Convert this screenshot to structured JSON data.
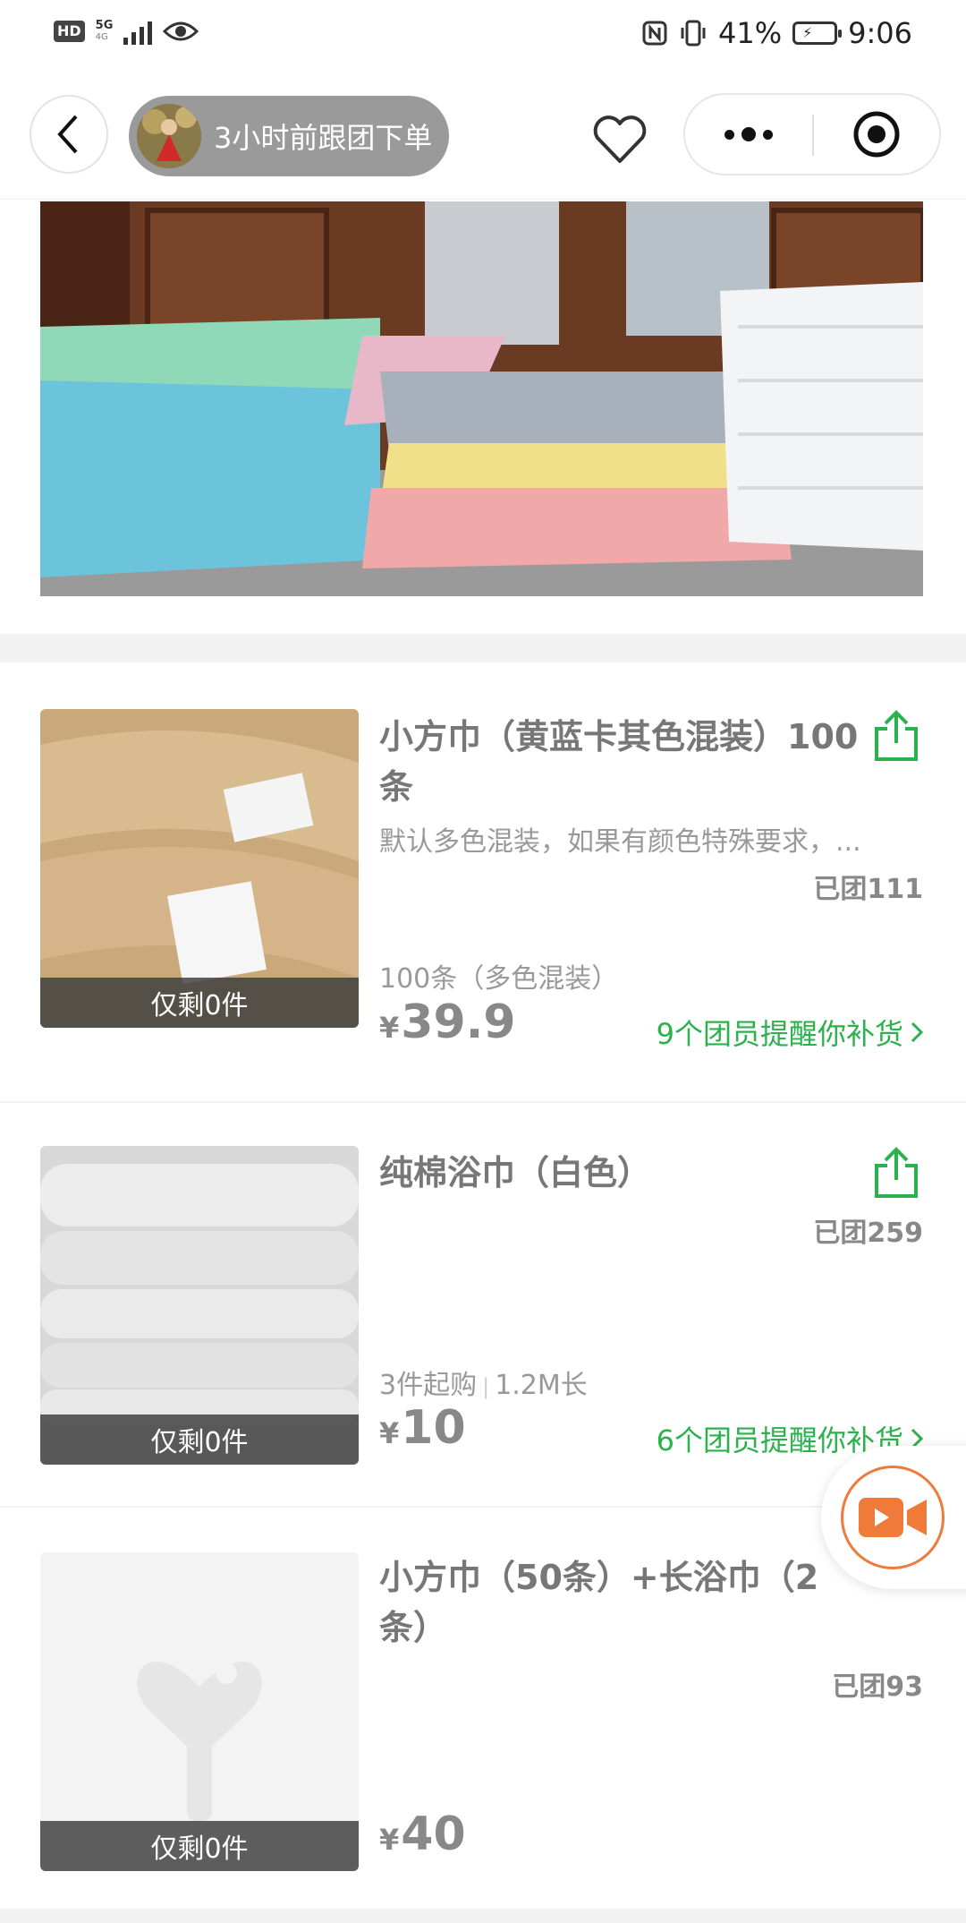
{
  "status_bar": {
    "hd": "HD",
    "network": "5G",
    "network_sub": "4G",
    "battery_percent": "41%",
    "time": "9:06"
  },
  "nav": {
    "order_notice": "3小时前跟团下单"
  },
  "products": [
    {
      "title": "小方巾（黄蓝卡其色混装）100条",
      "description": "默认多色混装，如果有颜色特殊要求，...",
      "sold": "已团111",
      "spec": "100条（多色混装）",
      "price_currency": "¥",
      "price": "39.9",
      "stock": "仅剩0件",
      "remind": "9个团员提醒你补货"
    },
    {
      "title": "纯棉浴巾（白色）",
      "sold": "已团259",
      "spec_a": "3件起购",
      "spec_b": "1.2M长",
      "price_currency": "¥",
      "price": "10",
      "stock": "仅剩0件",
      "remind": "6个团员提醒你补货"
    },
    {
      "title": "小方巾（50条）+长浴巾（2条）",
      "sold": "已团93",
      "price_currency": "¥",
      "price": "40",
      "stock": "仅剩0件"
    }
  ],
  "colors": {
    "accent_green": "#2bb24c",
    "video_orange": "#f07a3a"
  },
  "icons": [
    "back-icon",
    "heart-icon",
    "more-icon",
    "target-icon",
    "share-icon",
    "video-icon",
    "chevron-right-icon"
  ]
}
